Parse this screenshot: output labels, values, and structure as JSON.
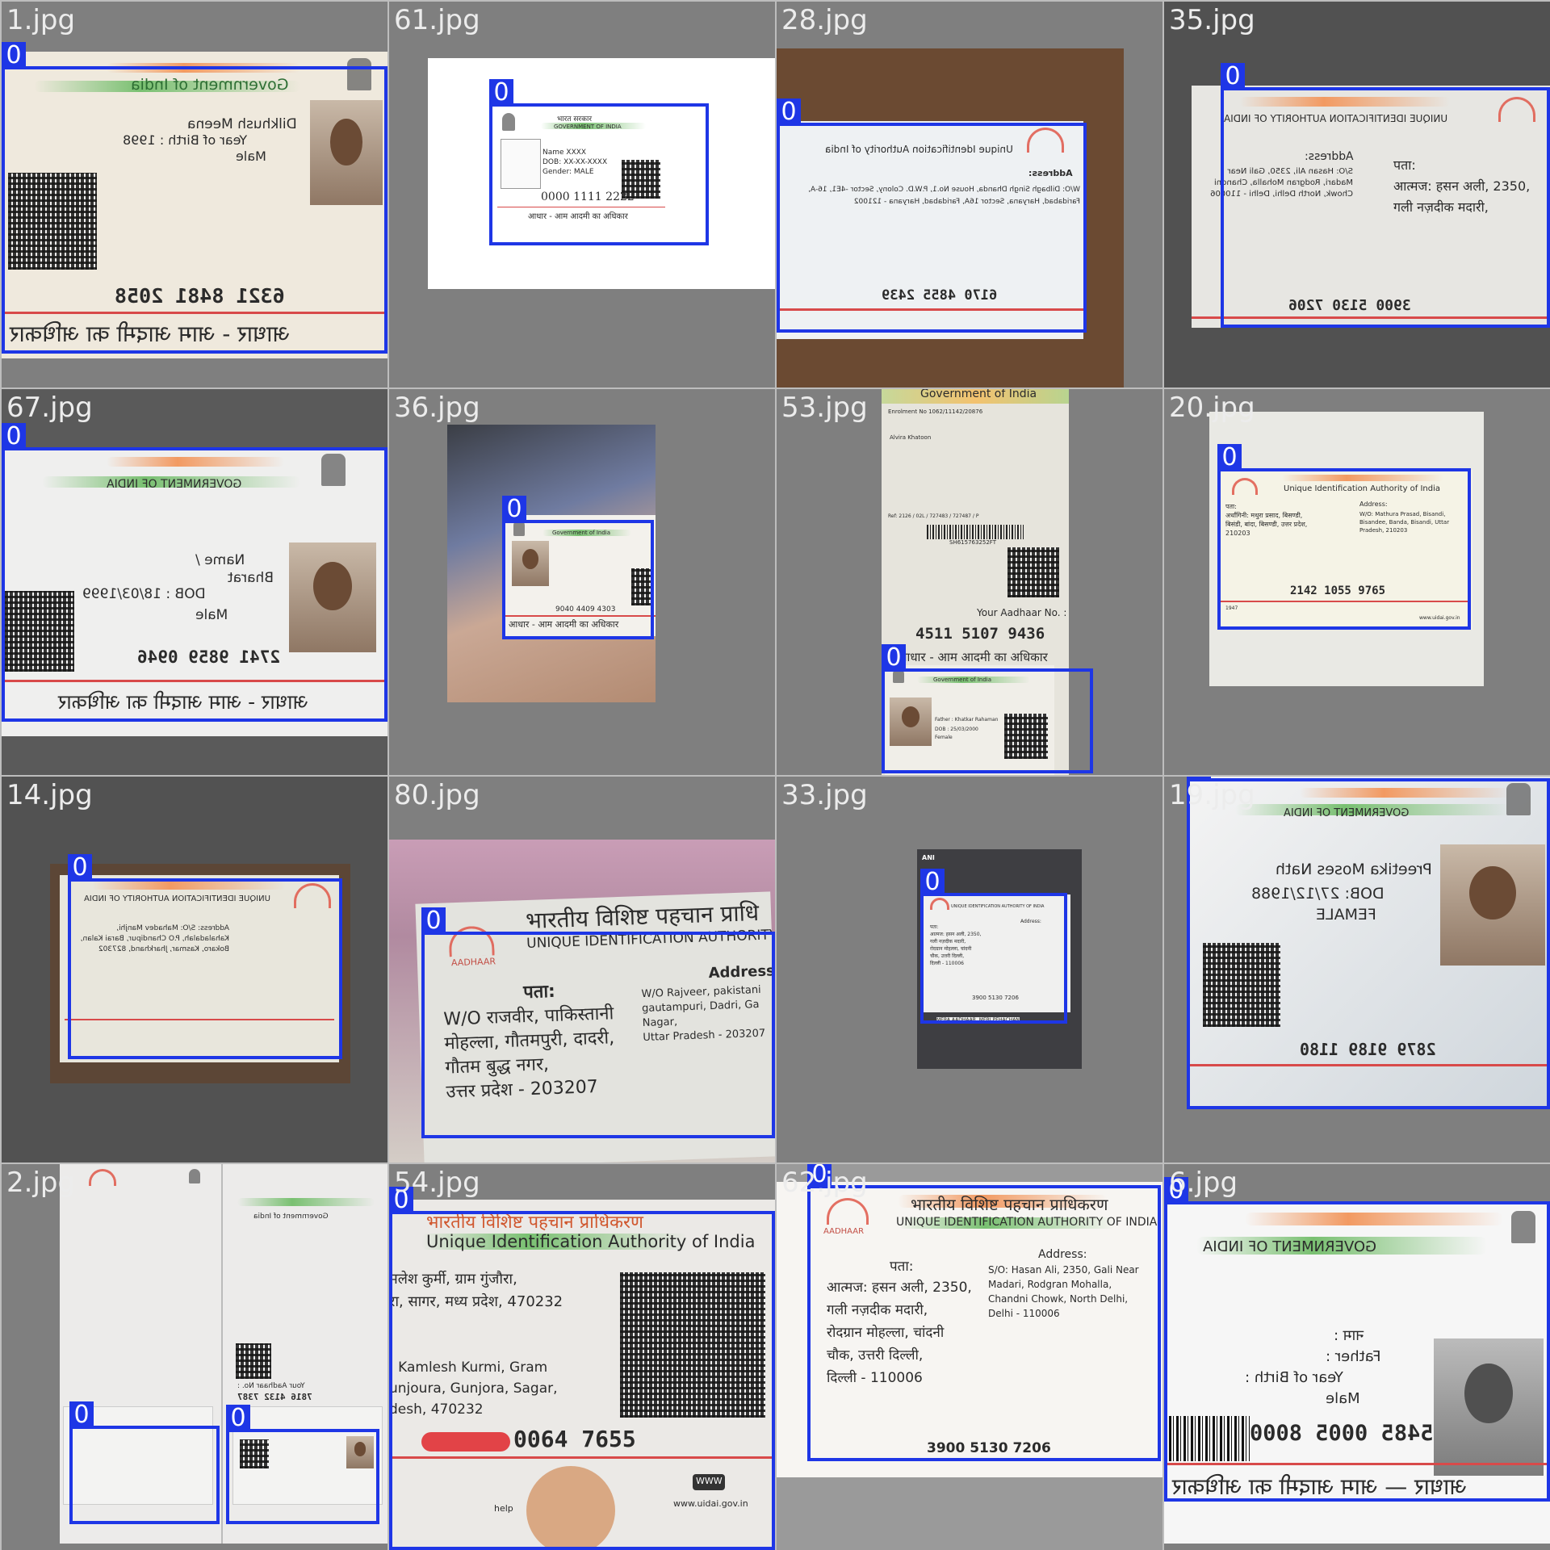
{
  "grid": {
    "tiles": [
      {
        "file": "1.jpg",
        "tag": "0"
      },
      {
        "file": "61.jpg",
        "tag": "0"
      },
      {
        "file": "28.jpg",
        "tag": "0"
      },
      {
        "file": "35.jpg",
        "tag": "0"
      },
      {
        "file": "67.jpg",
        "tag": "0"
      },
      {
        "file": "36.jpg",
        "tag": "0"
      },
      {
        "file": "53.jpg",
        "tag": "0"
      },
      {
        "file": "20.jpg",
        "tag": "0"
      },
      {
        "file": "14.jpg",
        "tag": "0"
      },
      {
        "file": "80.jpg",
        "tag": "0"
      },
      {
        "file": "33.jpg",
        "tag": "0"
      },
      {
        "file": "19.jpg",
        "tag": "0"
      },
      {
        "file": "2.jpg",
        "tag": "0"
      },
      {
        "file": "54.jpg",
        "tag": "0"
      },
      {
        "file": "62.jpg",
        "tag": "0"
      },
      {
        "file": "6.jpg",
        "tag": "0"
      }
    ]
  },
  "cards": {
    "t1": {
      "gov": "Government of India",
      "name": "Dilkhush Meena",
      "birth": "Year of Birth : 1998",
      "gender": "Male",
      "number": "6321 8481 2058",
      "footer": "आधार - आम आदमी का अधिकार"
    },
    "t2": {
      "gov_hi": "भारत सरकार",
      "gov": "GOVERNMENT OF INDIA",
      "name": "Name XXXX",
      "dob": "DOB: XX-XX-XXXX",
      "gender": "Gender: MALE",
      "number": "0000 1111 2222",
      "footer": "आधार - आम आदमी का अधिकार"
    },
    "t3": {
      "authority": "Unique Identification Authority of India",
      "address_label": "Address:",
      "address": "W/O: Dilbagh Singh Dhanda, House No.1, P.W.D. Colony, Sector -4E1, 16-A, Faridabad, Haryana, Sector 16A, Faridabad, Haryana - 121002",
      "number": "6170 4855 2439"
    },
    "t4": {
      "authority": "UNIQUE IDENTIFICATION AUTHORITY OF INDIA",
      "address_label": "Address:",
      "address": "S/O: Hasan Ali, 2350, Gali Near Madari, Rodgran Mohalla, Chandni Chowk, North Delhi, Delhi - 110006",
      "number": "3900 5130 7206"
    },
    "t5": {
      "gov": "GOVERNMENT OF INDIA",
      "name_label": "Name /",
      "name": "Bharat",
      "dob": "DOB : 18/03/1999",
      "gender": "Male",
      "number": "2741 9859 0946",
      "footer": "आधार - आम आदमी का अधिकार"
    },
    "t6": {
      "gov": "Government of India",
      "number": "9040 4409 4303",
      "footer": "आधार - आम आदमी का अधिकार"
    },
    "t7": {
      "gov": "Government of India",
      "enrol": "Enrolment No 1062/11142/20876",
      "name": "Alvira Khatoon",
      "ref": "Ref: 2126 / 02L / 727483 / 727487 / P",
      "barcode_text": "SH615763252FT",
      "your_no": "Your Aadhaar No. :",
      "number": "4511 5107 9436",
      "footer": "आधार - आम आदमी का अधिकार",
      "card_gov": "Government of India",
      "father": "Father : Khatkar Rahaman",
      "dob": "DOB : 25/03/2000",
      "gender": "Female"
    },
    "t8": {
      "authority": "Unique Identification Authority of India",
      "address_label": "Address:",
      "address": "W/O: Mathura Prasad, Bisandi, Bisandee, Banda, Bisandi, Uttar Pradesh, 210203",
      "number": "2142 1055 9765",
      "phone": "1947",
      "web": "www.uidai.gov.in"
    },
    "t9": {
      "authority": "UNIQUE IDENTIFICATION AUTHORITY OF INDIA",
      "address": "Address: S/O: Mahadev Manjhi, Kahaladalah, P.O Chandipur, Barai Kalan, Bokaro, Kasmar, Jharkhand, 827302"
    },
    "t10": {
      "authority_hi": "भारतीय विशिष्ट पहचान प्राधि",
      "authority": "UNIQUE IDENTIFICATION AUTHORITY",
      "logo": "AADHAAR",
      "pata": "पता:",
      "hi_lines": [
        "W/O राजवीर, पाकिस्तानी",
        "मोहल्ला, गौतमपुरी, दादरी,",
        "गौतम बुद्ध नगर,",
        "उत्तर प्रदेश - 203207"
      ],
      "address_label": "Address:",
      "en_lines": [
        "W/O Rajveer, pakistani",
        "gautampuri, Dadri, Ga",
        "Nagar,",
        "Uttar Pradesh - 203207"
      ]
    },
    "t11": {
      "badge": "ANI",
      "authority": "UNIQUE IDENTIFICATION AUTHORITY OF INDIA",
      "address_label": "Address:",
      "number": "3900 5130 7206",
      "footer": "MERA AADHAAR, MERI PEHACHAN"
    },
    "t12": {
      "gov": "GOVERNMENT OF INDIA",
      "name": "Preetika Moses Nath",
      "dob": "DOB: 27/12/1988",
      "gender": "FEMALE",
      "number": "2879 9189 1180"
    },
    "t13": {
      "number": "7816 4132 7387",
      "your_no": "Your Aadhaar No. :",
      "gov": "Government of India"
    },
    "t14": {
      "authority_hi": "भारतीय विशिष्ट पहचान प्राधिकरण",
      "authority": "Unique Identification Authority of India",
      "hi_lines": [
        "मलेश कुर्मी, ग्राम गुंजौरा,",
        "रा, सागर, मध्य प्रदेश, 470232"
      ],
      "en_lines": [
        ": Kamlesh Kurmi, Gram",
        "unjoura, Gunjora, Sagar,",
        "desh, 470232"
      ],
      "number": "0064 7655",
      "web": "www.uidai.gov.in",
      "www": "WWW",
      "help": "help"
    },
    "t15": {
      "authority_hi": "भारतीय विशिष्ट पहचान प्राधिकरण",
      "authority": "UNIQUE IDENTIFICATION AUTHORITY OF INDIA",
      "logo": "AADHAAR",
      "pata": "पता:",
      "hi_lines": [
        "आत्मज: हसन अली, 2350,",
        "गली नज़दीक मदारी,",
        "रोदग्रान मोहल्ला, चांदनी",
        "चौक, उत्तरी दिल्ली,",
        "दिल्ली - 110006"
      ],
      "address_label": "Address:",
      "en_lines": [
        "S/O: Hasan Ali, 2350, Gali Near",
        "Madari, Rodgran Mohalla,",
        "Chandni Chowk, North Delhi,",
        "Delhi - 110006"
      ],
      "number": "3900 5130 7206"
    },
    "t16": {
      "gov": "GOVERNMENT OF INDIA",
      "name_label": "नाम :",
      "father": "Father :",
      "birth": "Year of Birth :",
      "gender": "Male",
      "number": "5485 0005 8000",
      "footer": "आधार — आम आदमी का अधिकार"
    }
  }
}
